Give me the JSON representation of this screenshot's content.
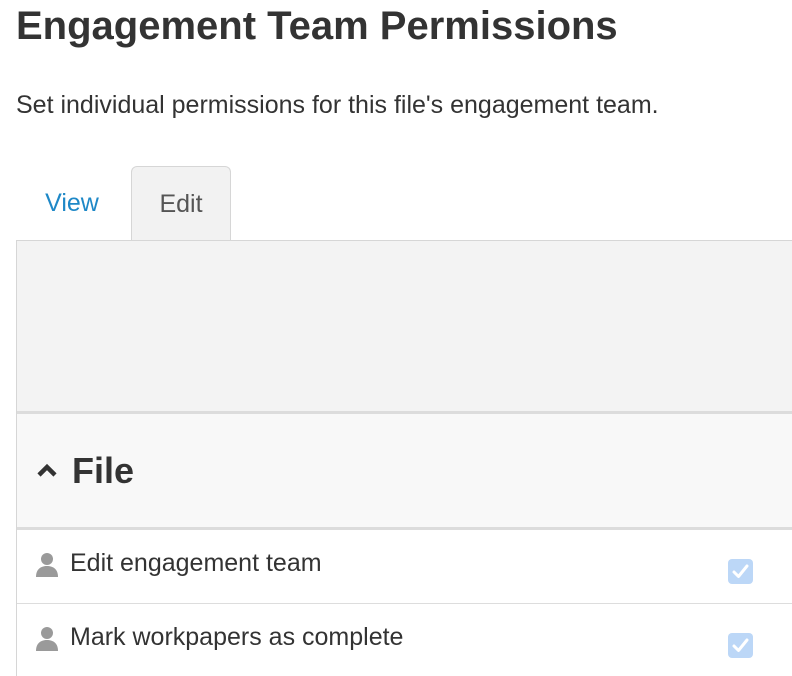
{
  "page": {
    "title": "Engagement Team Permissions",
    "subtitle": "Set individual permissions for this file's engagement team."
  },
  "tabs": [
    {
      "label": "View",
      "active": false
    },
    {
      "label": "Edit",
      "active": true
    }
  ],
  "section": {
    "title": "File",
    "expanded": true,
    "icon": "chevron-up-icon"
  },
  "permissions": [
    {
      "label": "Edit engagement team",
      "icon": "user-icon",
      "checked": true
    },
    {
      "label": "Mark workpapers as complete",
      "icon": "user-icon",
      "checked": true
    }
  ],
  "colors": {
    "link": "#1e88c7",
    "checkbox_fill": "#bcd7f7",
    "text": "#333333"
  }
}
